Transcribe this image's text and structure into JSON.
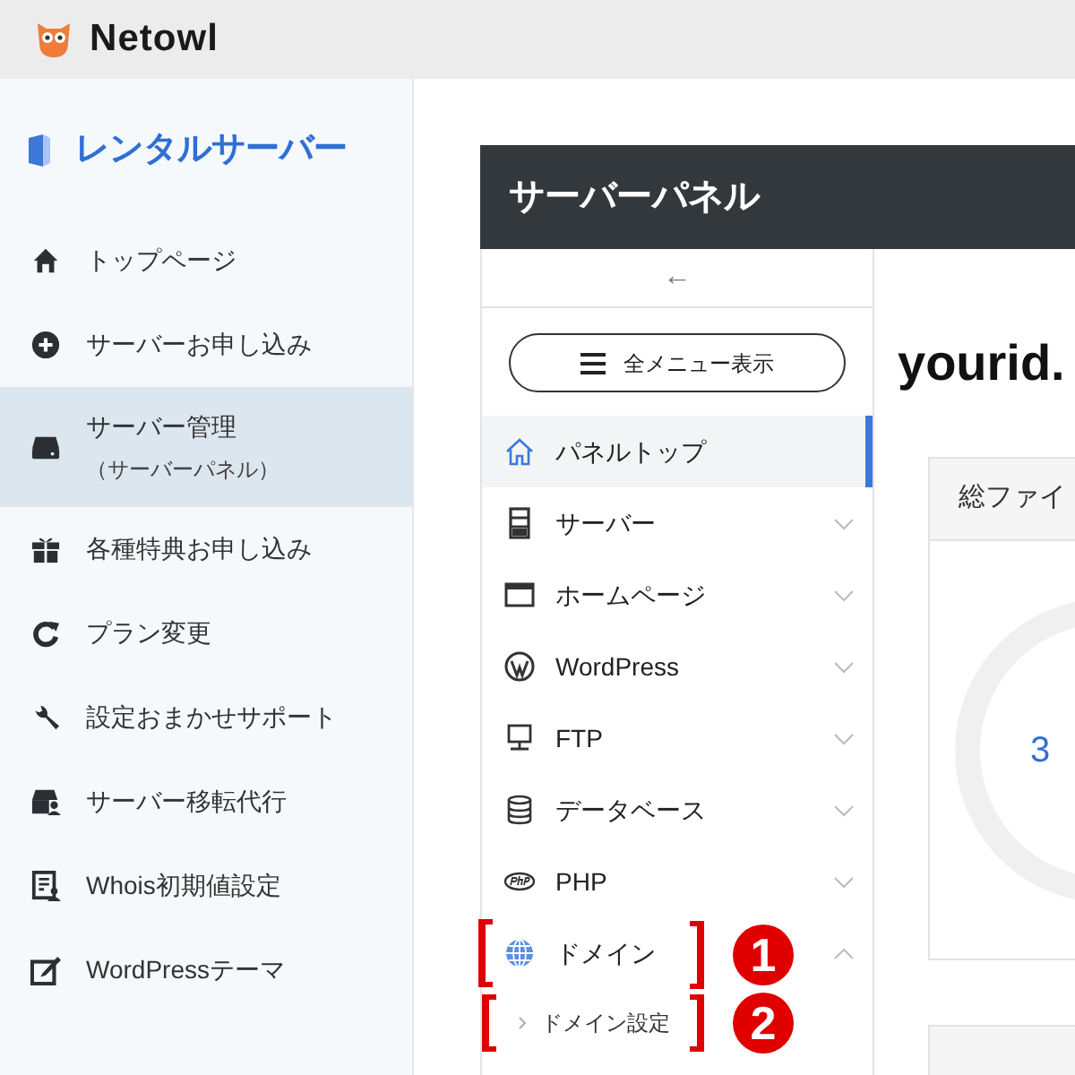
{
  "header": {
    "logo": "Netowl"
  },
  "sidebar": {
    "title": "レンタルサーバー",
    "items": [
      {
        "kind": "home",
        "label": "トップページ",
        "selected": false
      },
      {
        "kind": "plus",
        "label": "サーバーお申し込み",
        "selected": false
      },
      {
        "kind": "drive",
        "label": "サーバー管理",
        "sublabel": "（サーバーパネル）",
        "selected": true
      },
      {
        "kind": "gift",
        "label": "各種特典お申し込み",
        "selected": false
      },
      {
        "kind": "refresh",
        "label": "プラン変更",
        "selected": false
      },
      {
        "kind": "wrench",
        "label": "設定おまかせサポート",
        "selected": false
      },
      {
        "kind": "move",
        "label": "サーバー移転代行",
        "selected": false
      },
      {
        "kind": "doc",
        "label": "Whois初期値設定",
        "selected": false
      },
      {
        "kind": "edit",
        "label": "WordPressテーマ",
        "selected": false
      }
    ]
  },
  "panel": {
    "title": "サーバーパネル",
    "back": "←",
    "menu_button": "全メニュー表示",
    "nav": [
      {
        "kind": "home",
        "label": "パネルトップ",
        "selected": true
      },
      {
        "kind": "server",
        "label": "サーバー",
        "selected": false,
        "expanded": false
      },
      {
        "kind": "window",
        "label": "ホームページ",
        "selected": false,
        "expanded": false
      },
      {
        "kind": "wp",
        "label": "WordPress",
        "selected": false,
        "expanded": false
      },
      {
        "kind": "ftp",
        "label": "FTP",
        "selected": false,
        "expanded": false
      },
      {
        "kind": "db",
        "label": "データベース",
        "selected": false,
        "expanded": false
      },
      {
        "kind": "php",
        "label": "PHP",
        "selected": false,
        "expanded": false
      },
      {
        "kind": "globe",
        "label": "ドメイン",
        "selected": false,
        "expanded": true,
        "marker": "1",
        "children": [
          {
            "label": "ドメイン設定",
            "marker": "2"
          }
        ]
      }
    ],
    "content": {
      "heading": "yourid.",
      "card_title": "総ファイ",
      "gauge_value": "3"
    }
  }
}
